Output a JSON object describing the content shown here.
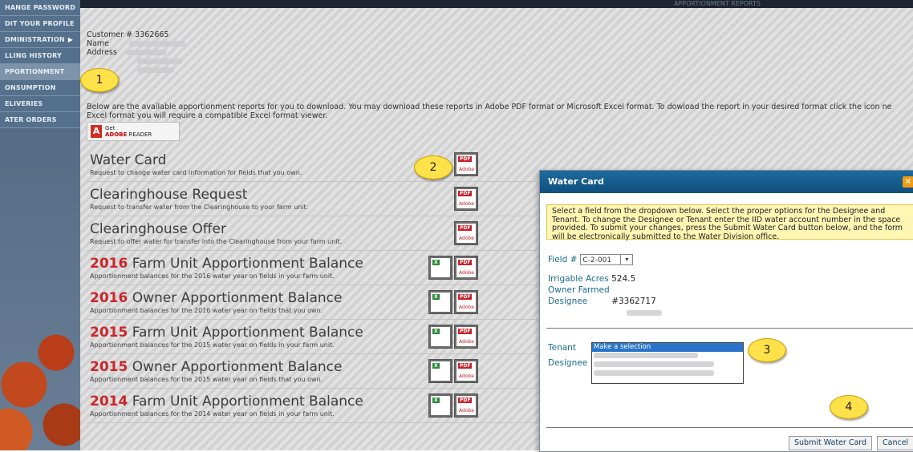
{
  "sidebar": {
    "items": [
      {
        "label": "HANGE PASSWORD"
      },
      {
        "label": "DIT YOUR PROFILE"
      },
      {
        "label": "DMINISTRATION"
      },
      {
        "label": "LLING HISTORY"
      },
      {
        "label": "PPORTIONMENT"
      },
      {
        "label": "ONSUMPTION"
      },
      {
        "label": "ELIVERIES"
      },
      {
        "label": "ATER ORDERS"
      }
    ],
    "submenu_arrow": "▶"
  },
  "header": {
    "title": "APPORTIONMENT REPORTS"
  },
  "customer": {
    "number_label": "Customer # 3362665",
    "name_label": "Name",
    "address_label": "Address"
  },
  "intro": {
    "line1": "Below are the available apportionment reports for you to download. You may download these reports in Adobe PDF format or Microsoft Excel format. To dowload the report in your desired format click the icon ne",
    "line2": "Excel format you will require a compatible Excel format viewer."
  },
  "adobe": {
    "get": "Get",
    "brand": "ADOBE",
    "product": "READER"
  },
  "reports": [
    {
      "year": "",
      "title": "Water Card",
      "desc": "Request to change water card information for fields that you own."
    },
    {
      "year": "",
      "title": "Clearinghouse Request",
      "desc": "Request to transfer water from the Clearinghouse to your farm unit."
    },
    {
      "year": "",
      "title": "Clearinghouse Offer",
      "desc": "Request to offer water for transfer into the Clearinghouse from your farm unit."
    },
    {
      "year": "2016",
      "title": " Farm Unit Apportionment Balance",
      "desc": "Apportionment balances for the 2016 water year on fields in your farm unit."
    },
    {
      "year": "2016",
      "title": " Owner Apportionment Balance",
      "desc": "Apportionment balances for the 2016 water year on fields that you own."
    },
    {
      "year": "2015",
      "title": " Farm Unit Apportionment Balance",
      "desc": "Apportionment balances for the 2015 water year on fields in your farm unit."
    },
    {
      "year": "2015",
      "title": " Owner Apportionment Balance",
      "desc": "Apportionment balances for the 2015 water year on fields that you own."
    },
    {
      "year": "2014",
      "title": " Farm Unit Apportionment Balance",
      "desc": "Apportionment balances for the 2014 water year on fields in your farm unit."
    }
  ],
  "icons": {
    "pdf_badge": "PDF",
    "pdf_label": "Adobe",
    "xls_badge": "X"
  },
  "callouts": {
    "c1": "1",
    "c2": "2",
    "c3": "3",
    "c4": "4"
  },
  "modal": {
    "title": "Water Card",
    "close": "×",
    "instructions": "Select a field from the dropdown below. Select the proper options for the Designee and Tenant. To change the Designee or Tenant enter the IID water account number in the space provided. To submit your changes, press the Submit Water Card button below, and the form will be electronically submitted to the Water Division office.",
    "field_label": "Field #",
    "field_value": "C-2-001",
    "irrigable_label": "Irrigable Acres",
    "irrigable_value": "524.5",
    "owner_label": "Owner Farmed",
    "designee_label": "Designee",
    "designee_value": "#3362717",
    "tenant_label": "Tenant",
    "designee2_label": "Designee",
    "tenant_options": [
      "Make a selection"
    ],
    "submit_label": "Submit Water Card",
    "cancel_label": "Cancel"
  }
}
